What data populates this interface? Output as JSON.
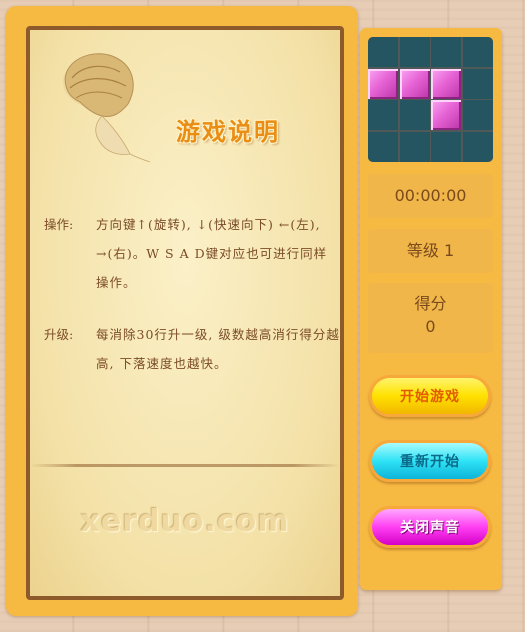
{
  "help": {
    "title": "游戏说明",
    "controls_label": "操作:",
    "controls_text": "方向键↑(旋转), ↓(快速向下) ←(左), →(右)。W S A D键对应也可进行同样操作。",
    "levels_label": "升级:",
    "levels_text": "每消除30行升一级, 级数越高消行得分越高, 下落速度也越快。",
    "watermark": "xerduo.com"
  },
  "stats": {
    "timer": "00:00:00",
    "level": "等级 1",
    "score_label": "得分",
    "score_value": "0"
  },
  "buttons": {
    "start": "开始游戏",
    "restart": "重新开始",
    "sound": "关闭声音"
  },
  "next_piece": {
    "grid": [
      [
        0,
        0,
        0,
        0
      ],
      [
        1,
        1,
        1,
        0
      ],
      [
        0,
        0,
        1,
        0
      ],
      [
        0,
        0,
        0,
        0
      ]
    ],
    "block_color": "#e764d6",
    "empty_color": "#245560"
  },
  "colors": {
    "frame": "#f6b942",
    "paper": "#f3e1a7",
    "title": "#e98d14"
  }
}
